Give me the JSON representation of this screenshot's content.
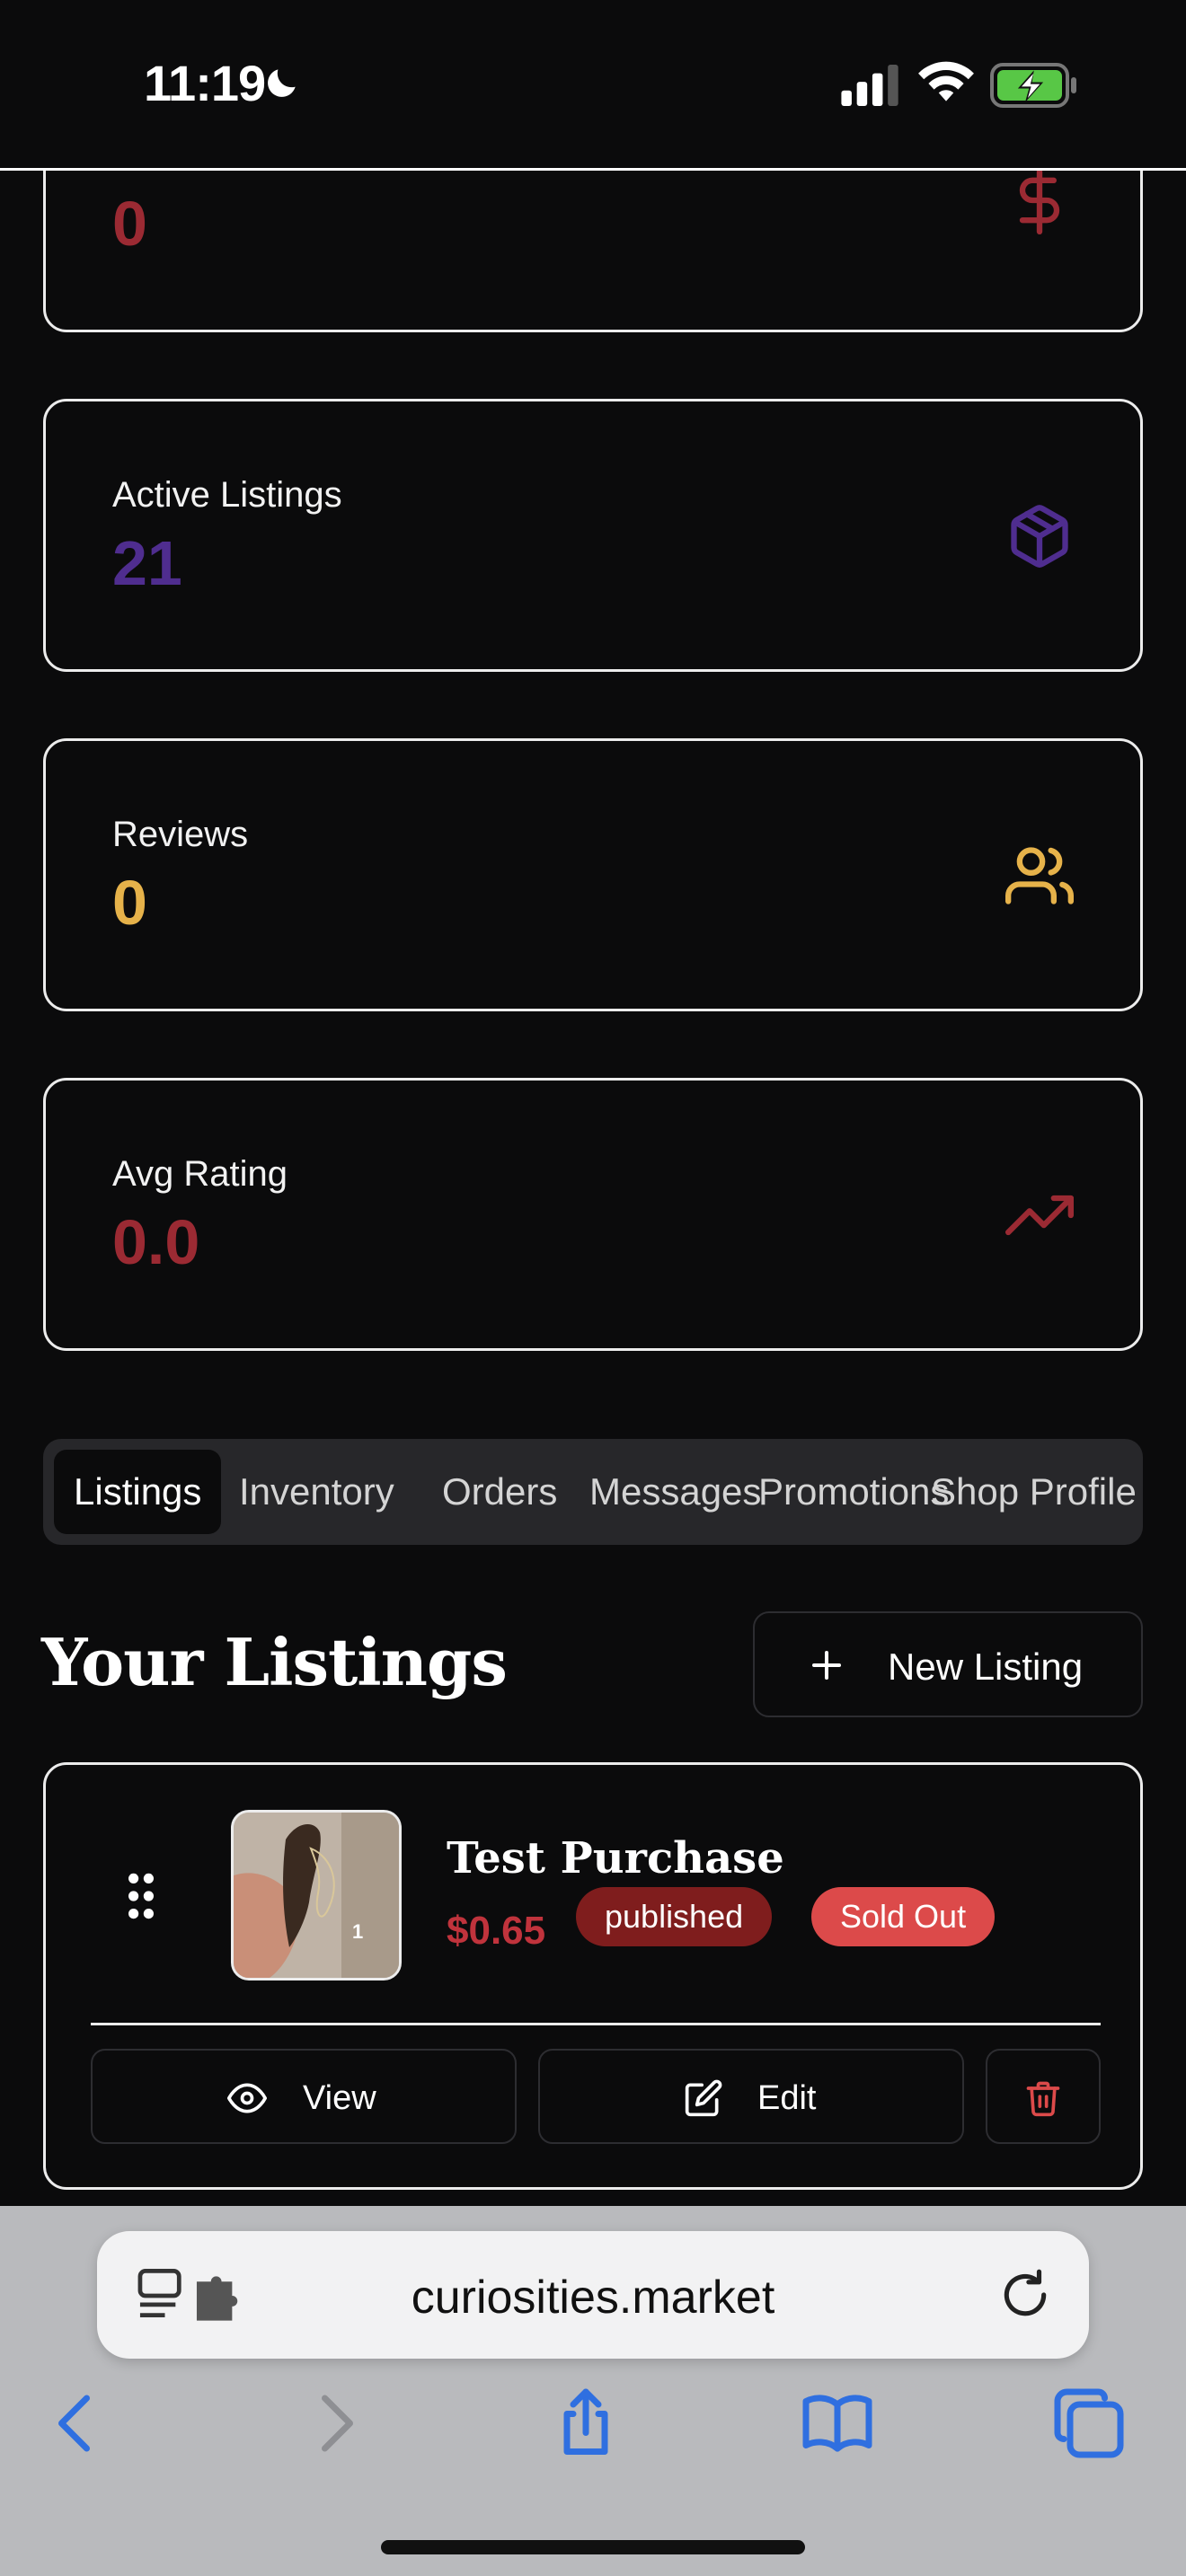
{
  "status_bar": {
    "time": "11:19"
  },
  "stats": [
    {
      "label": "",
      "value": "0",
      "icon": "dollar-icon",
      "color": "#9b2a33"
    },
    {
      "label": "Active Listings",
      "value": "21",
      "icon": "package-icon",
      "color": "#4f2d8f"
    },
    {
      "label": "Reviews",
      "value": "0",
      "icon": "users-icon",
      "color": "#e6b24a"
    },
    {
      "label": "Avg Rating",
      "value": "0.0",
      "icon": "trending-up-icon",
      "color": "#9b2a33"
    }
  ],
  "tabs": [
    "Listings",
    "Inventory",
    "Orders",
    "Messages",
    "Promotions",
    "Shop Profile"
  ],
  "active_tab": "Listings",
  "listings_section": {
    "title": "Your Listings",
    "new_listing_label": "New Listing"
  },
  "listing": {
    "title": "Test Purchase",
    "price": "$0.65",
    "status_badge": "published",
    "stock_badge": "Sold Out",
    "view_label": "View",
    "edit_label": "Edit"
  },
  "browser": {
    "url": "curiosities.market"
  },
  "colors": {
    "accent_red": "#c0333c",
    "published_bg": "#7f1d1d",
    "soldout_bg": "#dc4a4a",
    "browser_blue": "#2f6fe0"
  }
}
